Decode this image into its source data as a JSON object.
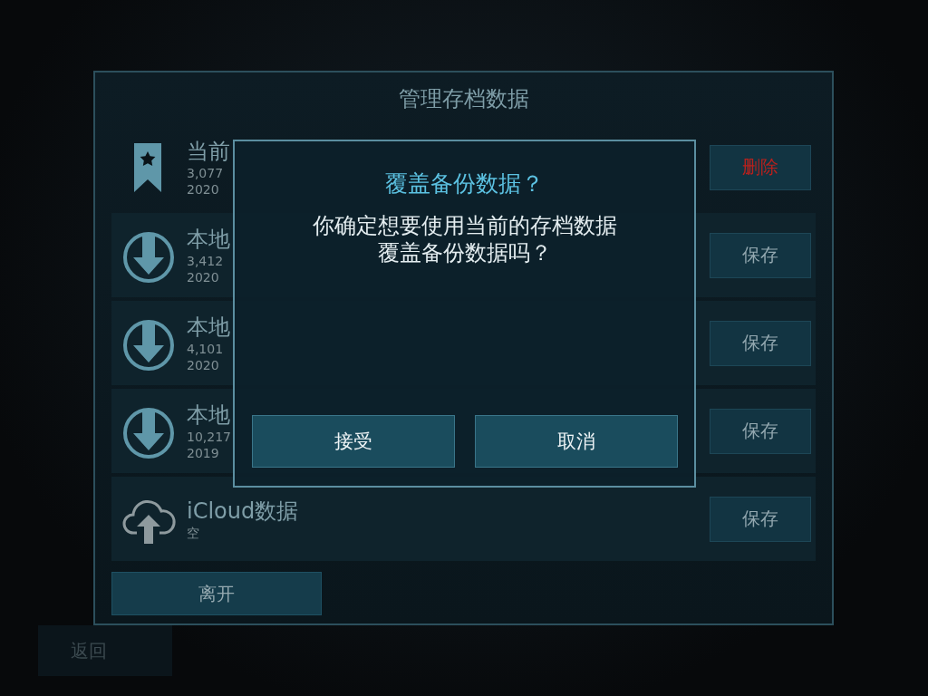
{
  "panel": {
    "title": "管理存档数据",
    "rows": [
      {
        "kind": "bookmark",
        "title": "当前",
        "details": [
          "3,077",
          "2020"
        ],
        "button": {
          "label": "删除",
          "kind": "danger"
        }
      },
      {
        "kind": "download",
        "title": "本地",
        "details": [
          "3,412",
          "2020"
        ],
        "button": {
          "label": "保存",
          "kind": "normal"
        }
      },
      {
        "kind": "download",
        "title": "本地",
        "details": [
          "4,101",
          "2020"
        ],
        "button": {
          "label": "保存",
          "kind": "normal"
        }
      },
      {
        "kind": "download",
        "title": "本地",
        "details": [
          "10,217",
          "2019"
        ],
        "button": {
          "label": "保存",
          "kind": "normal"
        }
      },
      {
        "kind": "cloud",
        "title": "iCloud数据",
        "details": [
          "空"
        ],
        "button": {
          "label": "保存",
          "kind": "normal"
        }
      }
    ],
    "leave_button": "离开"
  },
  "back_button": "返回",
  "dialog": {
    "title": "覆盖备份数据？",
    "message_lines": [
      "你确定想要使用当前的存档数据",
      "覆盖备份数据吗？"
    ],
    "buttons": [
      "接受",
      "取消"
    ]
  }
}
